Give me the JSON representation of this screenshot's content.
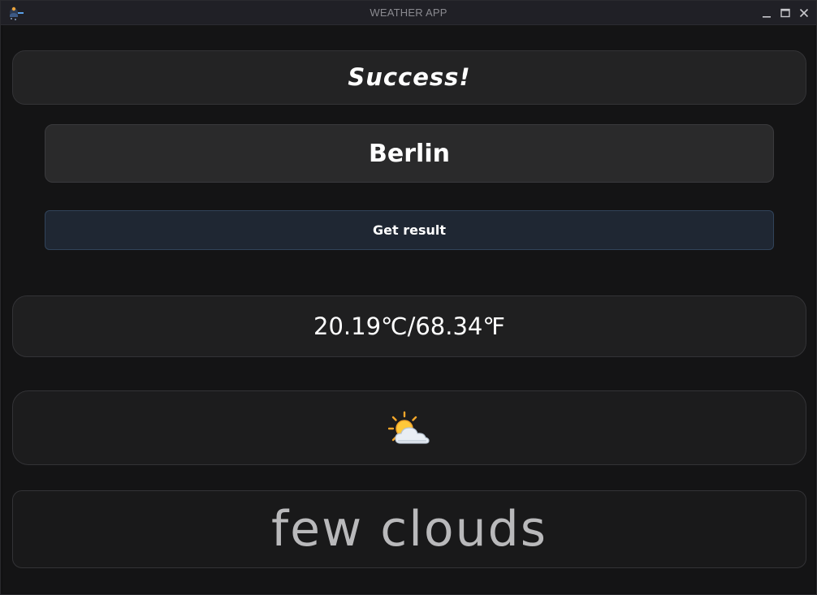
{
  "window": {
    "title": "WEATHER APP"
  },
  "status": {
    "message": "Success!"
  },
  "search": {
    "city_value": "Berlin"
  },
  "actions": {
    "get_result_label": "Get result"
  },
  "weather": {
    "temperature": "20.19℃/68.34℉",
    "icon": "sun-behind-cloud-icon",
    "description": "few clouds"
  },
  "colors": {
    "accent_button_bg": "#1f2733",
    "text_primary": "#ffffff",
    "text_description": "#b9b9bb",
    "panel_bg": "#222223"
  }
}
